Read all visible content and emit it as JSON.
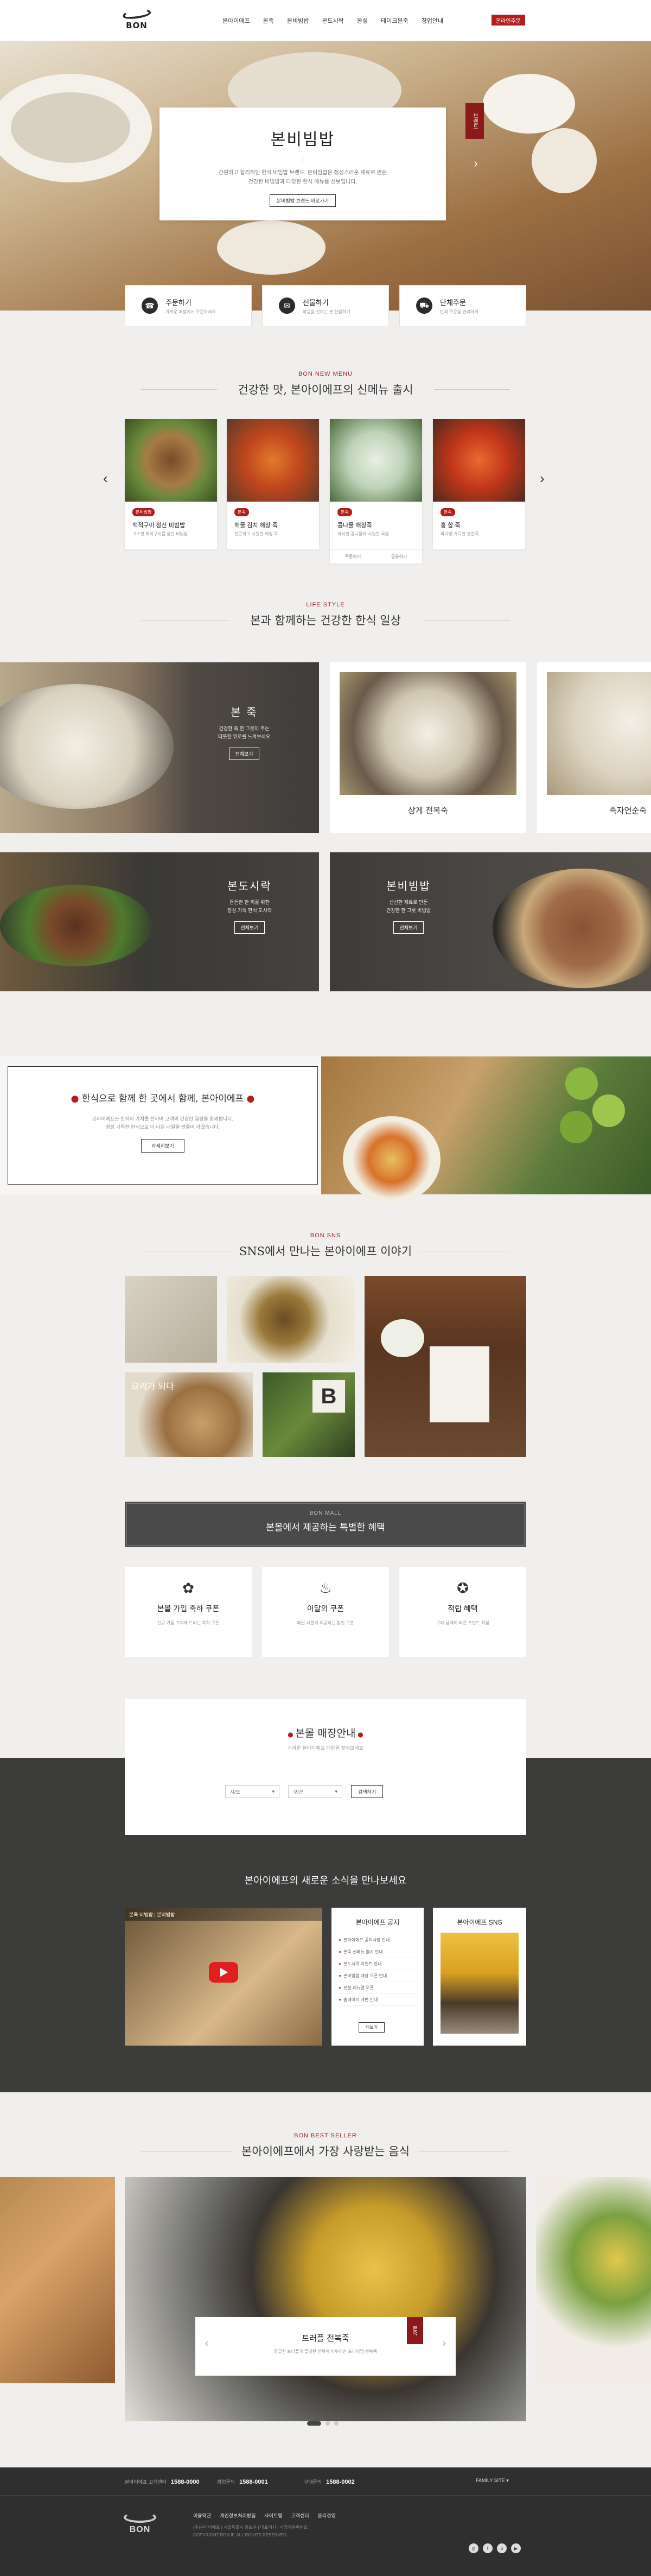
{
  "brand": {
    "logo_text": "BON"
  },
  "nav": {
    "items": [
      "본아이에프",
      "본죽",
      "본비빔밥",
      "본도시락",
      "본설",
      "테이크본죽",
      "창업안내"
    ],
    "order_button": "온라인주문"
  },
  "hero": {
    "title": "본비빔밥",
    "desc_line1": "간편하고 합리적인 한식 비빔밥 브랜드. 본비빔밥은 정성스러운 재료로 만든",
    "desc_line2": "건강한 비빔밥과 다양한 한식 메뉴를 선보입니다.",
    "more": "본비빔밥 브랜드 바로가기",
    "tag": "브랜드"
  },
  "quick": [
    {
      "icon": "phone-icon",
      "glyph": "☎",
      "title": "주문하기",
      "sub": "가까운 매장에서 주문하세요"
    },
    {
      "icon": "gift-icon",
      "glyph": "✉",
      "title": "선물하기",
      "sub": "마음을 전하는 본 선물하기"
    },
    {
      "icon": "truck-icon",
      "glyph": "⛟",
      "title": "단체주문",
      "sub": "단체 주문을 편리하게"
    }
  ],
  "new_menu": {
    "label": "BON NEW MENU",
    "title": "건강한 맛, 본아이에프의 신메뉴 출시",
    "cards": [
      {
        "badge": "본비빔밥",
        "name": "맥적구이 정산 비빔밥",
        "desc": "고소한 맥적구이를 올린 비빔밥"
      },
      {
        "badge": "본죽",
        "name": "해물 김치 해장 죽",
        "desc": "얼큰하고 시원한 해장 죽",
        "buy": "주문하기",
        "share": "공유하기"
      },
      {
        "badge": "본죽",
        "name": "콩나물 해장죽",
        "desc": "아삭한 콩나물과 시원한 국물"
      },
      {
        "badge": "본죽",
        "name": "홍 합 죽",
        "desc": "바다향 가득한 홍합죽"
      }
    ]
  },
  "lifestyle": {
    "label": "LIFE STYLE",
    "title": "본과 함께하는 건강한 한식 일상",
    "bonjuk": {
      "title": "본 죽",
      "desc1": "건강한 죽 한 그릇이 주는",
      "desc2": "따뜻한 위로를 느껴보세요",
      "btn": "전체보기"
    },
    "card1": "상게 전복죽",
    "card2": "족자연순죽",
    "bondosirak": {
      "title": "본도시락",
      "desc1": "든든한 한 끼를 위한",
      "desc2": "정성 가득 한식 도시락",
      "btn": "전체보기"
    },
    "bonbibim": {
      "title": "본비빔밥",
      "desc1": "신선한 재료로 만든",
      "desc2": "건강한 한 그릇 비빔밥",
      "btn": "전체보기"
    }
  },
  "hansik": {
    "title": "한식으로 함께 한 곳에서 함께, 본아이에프",
    "desc1": "본아이에프는 한식의 가치를 전하며 고객의 건강한 일상을 함께합니다.",
    "desc2": "정성 가득한 한식으로 더 나은 내일을 만들어 가겠습니다.",
    "btn": "자세히보기"
  },
  "sns": {
    "label": "BON SNS",
    "title": "SNS에서 만나는 본아이에프 이야기",
    "overlay_text": "요리가 되다",
    "badge": "B"
  },
  "mall": {
    "label": "BON MALL",
    "title": "본몰에서 제공하는 특별한 혜택",
    "cards": [
      {
        "icon": "gift-icon",
        "glyph": "✿",
        "title": "본몰 가입 축하 쿠폰",
        "desc": "신규 가입 고객께 드리는 축하 쿠폰"
      },
      {
        "icon": "coupon-icon",
        "glyph": "♨",
        "title": "이달의 쿠폰",
        "desc": "매달 새롭게 제공되는 할인 쿠폰"
      },
      {
        "icon": "star-icon",
        "glyph": "✪",
        "title": "적립 혜택",
        "desc": "구매 금액에 따른 포인트 적립"
      }
    ]
  },
  "store": {
    "title": "본몰 매장안내",
    "desc": "가까운 본아이에프 매장을 찾아보세요",
    "select1": "시/도",
    "select2": "구/군",
    "search": "검색하기"
  },
  "news": {
    "title": "본아이에프의 새로운 소식을 만나보세요",
    "video_title": "본죽 비빔밥 | 본비빔밥",
    "notice_title": "본아이에프 공지",
    "notice_items": [
      "본아이에프 공지사항 안내",
      "본죽 신메뉴 출시 안내",
      "본도시락 이벤트 안내",
      "본비빔밥 매장 오픈 안내",
      "본설 리뉴얼 오픈",
      "홈페이지 개편 안내"
    ],
    "notice_btn": "더보기",
    "sns_title": "본아이에프 SNS"
  },
  "best": {
    "label": "BON BEST SELLER",
    "title": "본아이에프에서 가장 사랑받는 음식",
    "caption_title": "트러플 전복죽",
    "caption_desc": "향긋한 트러플과 쫄깃한 전복이 어우러진 프리미엄 전복죽",
    "tag": "본죽"
  },
  "footer": {
    "n1_label": "본아이에프 고객센터",
    "n1": "1588-0000",
    "n2_label": "창업문의",
    "n2": "1588-0001",
    "n3_label": "구매문의",
    "n3": "1588-0002",
    "family": "FAMILY SITE",
    "links": [
      "이용약관",
      "개인정보처리방침",
      "사이트맵",
      "고객센터",
      "윤리경영"
    ],
    "addr": "(주)본아이에프 | 서울특별시 종로구 | 대표이사 | 사업자등록번호",
    "copy": "COPYRIGHT BON IF. ALL RIGHTS RESERVED."
  }
}
